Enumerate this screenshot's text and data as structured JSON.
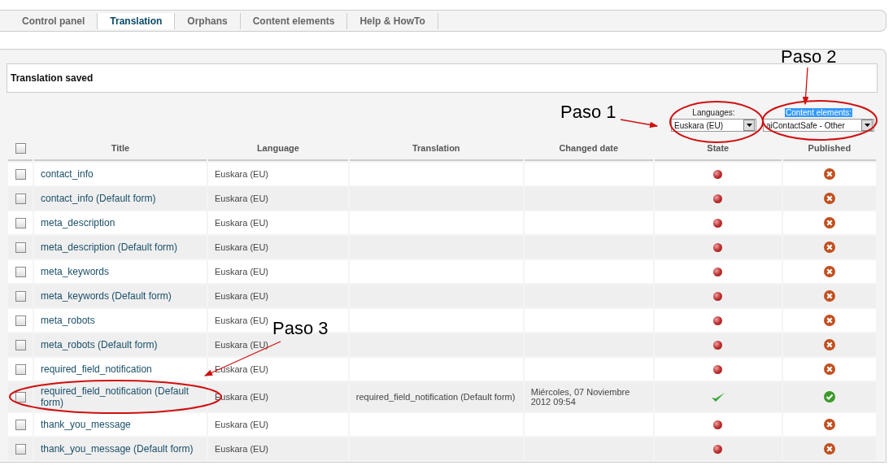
{
  "tabs": [
    {
      "label": "Control panel",
      "selected": false
    },
    {
      "label": "Translation",
      "selected": true
    },
    {
      "label": "Orphans",
      "selected": false
    },
    {
      "label": "Content elements",
      "selected": false
    },
    {
      "label": "Help & HowTo",
      "selected": false
    }
  ],
  "message": "Translation saved",
  "filters": [
    {
      "label": "Languages:",
      "value": "Euskara (EU)",
      "highlighted": false
    },
    {
      "label": "Content elements:",
      "value": "aiContactSafe - Other",
      "highlighted": true
    }
  ],
  "table": {
    "select_all_checked": false,
    "columns": [
      "Title",
      "Language",
      "Translation",
      "Changed date",
      "State",
      "Published"
    ],
    "rows": [
      {
        "title": "contact_info",
        "language": "Euskara (EU)",
        "checked": false,
        "translated": false,
        "published": false
      },
      {
        "title": "contact_info (Default form)",
        "language": "Euskara (EU)",
        "checked": false,
        "translated": false,
        "published": false
      },
      {
        "title": "meta_description",
        "language": "Euskara (EU)",
        "checked": false,
        "translated": false,
        "published": false
      },
      {
        "title": "meta_description (Default form)",
        "language": "Euskara (EU)",
        "checked": false,
        "translated": false,
        "published": false
      },
      {
        "title": "meta_keywords",
        "language": "Euskara (EU)",
        "checked": false,
        "translated": false,
        "published": false
      },
      {
        "title": "meta_keywords (Default form)",
        "language": "Euskara (EU)",
        "checked": false,
        "translated": false,
        "published": false
      },
      {
        "title": "meta_robots",
        "language": "Euskara (EU)",
        "checked": false,
        "translated": false,
        "published": false
      },
      {
        "title": "meta_robots (Default form)",
        "language": "Euskara (EU)",
        "checked": false,
        "translated": false,
        "published": false
      },
      {
        "title": "required_field_notification",
        "language": "Euskara (EU)",
        "checked": false,
        "translated": false,
        "published": false
      },
      {
        "title": "required_field_notification (Default form)",
        "language": "Euskara (EU)",
        "translation": "required_field_notification (Default form)",
        "changed_date": "Miércoles, 07 Noviembre 2012 09:54",
        "checked": false,
        "translated": true,
        "published": true
      },
      {
        "title": "thank_you_message",
        "language": "Euskara (EU)",
        "checked": false,
        "translated": false,
        "published": false
      },
      {
        "title": "thank_you_message (Default form)",
        "language": "Euskara (EU)",
        "checked": false,
        "translated": false,
        "published": false
      }
    ]
  },
  "annotations": [
    {
      "label": "Paso 1"
    },
    {
      "label": "Paso 2"
    },
    {
      "label": "Paso 3"
    }
  ]
}
